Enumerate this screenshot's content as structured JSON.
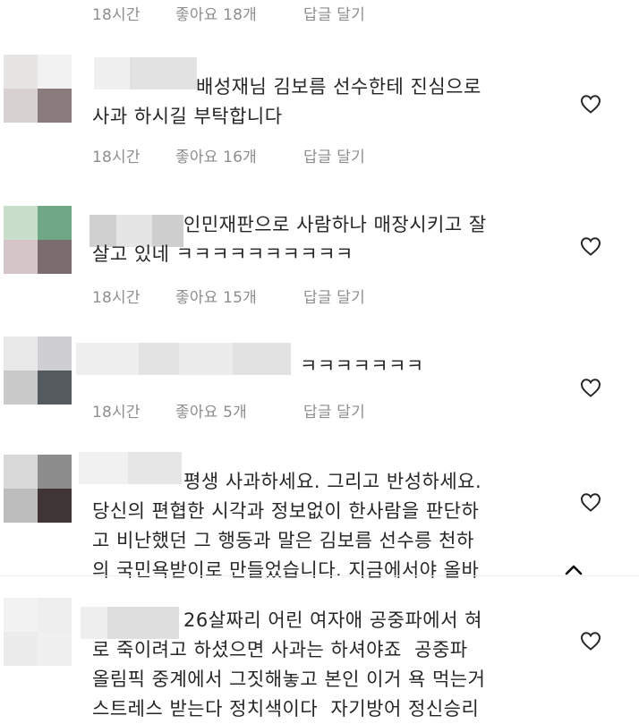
{
  "top_meta": {
    "time": "18시간",
    "likes": "좋아요 18개",
    "reply": "답글 달기"
  },
  "comments": [
    {
      "lines": [
        "배성재님 김보름 선수한테 진심으로",
        "사과 하시길 부탁합니다"
      ],
      "time": "18시간",
      "likes": "좋아요 16개",
      "reply": "답글 달기"
    },
    {
      "lines": [
        "인민재판으로 사람하나 매장시키고 잘",
        "살고 있네 ㅋㅋㅋㅋㅋㅋㅋㅋㅋㅋ"
      ],
      "time": "18시간",
      "likes": "좋아요 15개",
      "reply": "답글 달기"
    },
    {
      "lines": [
        "ㅋㅋㅋㅋㅋㅋㅋ"
      ],
      "time": "18시간",
      "likes": "좋아요 5개",
      "reply": "답글 달기"
    },
    {
      "lines": [
        "평생 사과하세요. 그리고 반성하세요.",
        "당신의 편협한 시각과 정보없이 한사람을 판단하",
        "고 비난했던 그 행동과 말은 김보름 선수릉 천하",
        "의 국민욕받이로 만들었습니다. 지금에서야 올바"
      ]
    },
    {
      "lines": [
        "26살짜리 어린 여자애 공중파에서 혀",
        "로 죽이려고 하셨으면 사과는 하셔야죠  공중파",
        "올림픽 중계에서 그짓해놓고 본인 이거 욕 먹는거",
        "스트레스 받는다 정치색이다  자기방어 정신승리"
      ]
    }
  ],
  "icons": {
    "heart": "heart-outline-icon",
    "chevron": "chevron-up-icon"
  },
  "colors": {
    "text": "#262626",
    "meta": "#8e8e8e",
    "heart": "#262626"
  }
}
